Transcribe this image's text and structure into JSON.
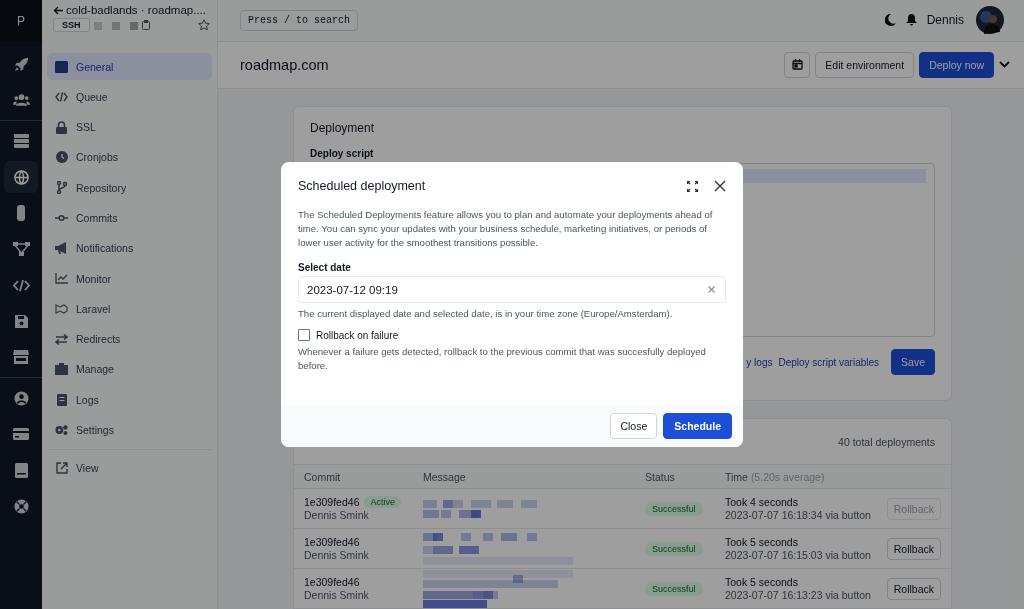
{
  "rail": {
    "logo": "P",
    "groups": [
      {
        "items": [
          {
            "selected": false
          },
          {
            "selected": false
          }
        ]
      },
      {
        "items": [
          {
            "selected": false
          },
          {
            "selected": true
          },
          {
            "selected": false
          },
          {
            "selected": false
          },
          {
            "selected": false
          },
          {
            "selected": false
          },
          {
            "selected": false
          }
        ]
      },
      {
        "items": [
          {
            "selected": false
          },
          {
            "selected": false
          },
          {
            "selected": false
          },
          {
            "selected": false
          }
        ]
      }
    ]
  },
  "sidebar": {
    "title": "cold-badlands · roadmap....",
    "badge": "SSH",
    "groups": [
      {
        "items": [
          {
            "label": "General",
            "selected": true
          },
          {
            "label": "Queue",
            "selected": false
          },
          {
            "label": "SSL",
            "selected": false
          },
          {
            "label": "Cronjobs",
            "selected": false
          },
          {
            "label": "Repository",
            "selected": false
          },
          {
            "label": "Commits",
            "selected": false
          },
          {
            "label": "Notifications",
            "selected": false
          },
          {
            "label": "Monitor",
            "selected": false
          },
          {
            "label": "Laravel",
            "selected": false
          },
          {
            "label": "Redirects",
            "selected": false
          },
          {
            "label": "Manage",
            "selected": false
          },
          {
            "label": "Logs",
            "selected": false
          },
          {
            "label": "Settings",
            "selected": false
          }
        ]
      },
      {
        "items": [
          {
            "label": "View",
            "selected": false
          }
        ]
      }
    ]
  },
  "topbar": {
    "search": "Press / to search",
    "user": "Dennis"
  },
  "header": {
    "title": "roadmap.com",
    "buttons": [
      "Edit environment",
      "Deploy now"
    ]
  },
  "deployment_card": {
    "title": "Deployment",
    "script_label": "Deploy script",
    "links": [
      "y logs",
      "Deploy script variables"
    ],
    "save": "Save"
  },
  "deployments": {
    "total": "40 total deployments",
    "columns": [
      "Commit",
      "Message",
      "Status",
      "Time"
    ],
    "time_note": "(5.20s average)",
    "rows": [
      {
        "commit": "1e309fed46",
        "badge": "Active",
        "author": "Dennis Smink",
        "status": "Successful",
        "duration": "Took 4 seconds",
        "when": "2023-07-07 16:18:34 via button",
        "action": "Rollback",
        "disabled": true
      },
      {
        "commit": "1e309fed46",
        "author": "Dennis Smink",
        "status": "Successful",
        "duration": "Took 5 seconds",
        "when": "2023-07-07 16:15:03 via button",
        "action": "Rollback",
        "disabled": false
      },
      {
        "commit": "1e309fed46",
        "author": "Dennis Smink",
        "status": "Successful",
        "duration": "Took 5 seconds",
        "when": "2023-07-07 16:13:23 via button",
        "action": "Rollback",
        "disabled": false
      }
    ]
  },
  "modal": {
    "title": "Scheduled deployment",
    "description": "The Scheduled Deployments feature allows you to plan and automate your deployments ahead of time. You can sync your updates with your business schedule, marketing initiatives, or periods of lower user activity for the smoothest transitions possible.",
    "date_label": "Select date",
    "date_value": "2023-07-12 09:19",
    "date_hint": "The current displayed date and selected date, is in your time zone (Europe/Amsterdam).",
    "rollback": {
      "label": "Rollback on failure",
      "checked": false
    },
    "rollback_hint": "Whenever a failure gets detected, rollback to the previous commit that was succesfully deployed before.",
    "buttons": [
      "Close",
      "Schedule"
    ]
  }
}
